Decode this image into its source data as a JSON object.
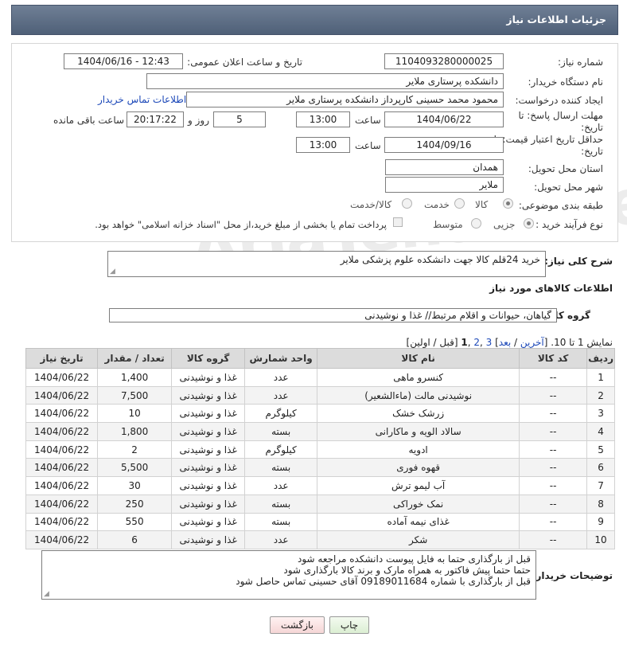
{
  "header": {
    "title": "جزئیات اطلاعات نیاز"
  },
  "form": {
    "need_number_label": "شماره نیاز:",
    "need_number": "1104093280000025",
    "announce_label": "تاریخ و ساعت اعلان عمومی:",
    "announce_value": "1404/06/16 - 12:43",
    "buyer_org_label": "نام دستگاه خریدار:",
    "buyer_org": "دانشکده پرستاری ملایر",
    "requester_label": "ایجاد کننده درخواست:",
    "requester": "محمود محمد حسینی کارپرداز دانشکده پرستاری ملایر",
    "buyer_contact_link": "اطلاعات تماس خریدار",
    "reply_deadline_label": "مهلت ارسال پاسخ: تا تاریخ:",
    "reply_date": "1404/06/22",
    "time_label": "ساعت",
    "reply_time": "13:00",
    "days_value": "5",
    "days_label": "روز و",
    "remaining_time": "20:17:22",
    "remaining_label": "ساعت باقی مانده",
    "price_validity_label": "حداقل تاریخ اعتبار قیمت: تا تاریخ:",
    "validity_date": "1404/09/16",
    "validity_time": "13:00",
    "province_label": "استان محل تحویل:",
    "province": "همدان",
    "city_label": "شهر محل تحویل:",
    "city": "ملایر",
    "category_label": "طبقه بندی موضوعی:",
    "category_options": [
      "کالا",
      "خدمت",
      "کالا/خدمت"
    ],
    "category_selected": "کالا",
    "process_label": "نوع فرآیند خرید :",
    "process_options": [
      "جزیی",
      "متوسط"
    ],
    "process_selected": "جزیی",
    "treasury_note": "پرداخت تمام یا بخشی از مبلغ خرید،از محل \"اسناد خزانه اسلامی\" خواهد بود."
  },
  "summary": {
    "label": "شرح کلی نیاز:",
    "text": "خرید 24قلم کالا جهت دانشکده علوم پزشکی ملایر"
  },
  "goods_section_title": "اطلاعات کالاهای مورد نیاز",
  "goods_group": {
    "label": "گروه کالا:",
    "value": "گیاهان، حیوانات و اقلام مرتبط// غذا و نوشیدنی"
  },
  "pagination": {
    "prefix": "نمایش 1 تا 10. [",
    "last": "آخرین",
    "sep1": " / ",
    "next": "بعد",
    "pages_open": "] ",
    "page3": "3",
    "comma1": " ,",
    "page2": "2",
    "comma2": " ,",
    "page1": "1",
    "suffix": " [قبل / اولین]"
  },
  "table": {
    "headers": [
      "ردیف",
      "کد کالا",
      "نام کالا",
      "واحد شمارش",
      "گروه کالا",
      "تعداد / مقدار",
      "تاریخ نیاز"
    ],
    "rows": [
      [
        "1",
        "--",
        "کنسرو ماهی",
        "عدد",
        "غذا و نوشیدنی",
        "1,400",
        "1404/06/22"
      ],
      [
        "2",
        "--",
        "نوشیدنی مالت (ماءالشعیر)",
        "عدد",
        "غذا و نوشیدنی",
        "7,500",
        "1404/06/22"
      ],
      [
        "3",
        "--",
        "زرشک خشک",
        "کیلوگرم",
        "غذا و نوشیدنی",
        "10",
        "1404/06/22"
      ],
      [
        "4",
        "--",
        "سالاد الویه و ماکارانی",
        "بسته",
        "غذا و نوشیدنی",
        "1,800",
        "1404/06/22"
      ],
      [
        "5",
        "--",
        "ادویه",
        "کیلوگرم",
        "غذا و نوشیدنی",
        "2",
        "1404/06/22"
      ],
      [
        "6",
        "--",
        "قهوه فوری",
        "بسته",
        "غذا و نوشیدنی",
        "5,500",
        "1404/06/22"
      ],
      [
        "7",
        "--",
        "آب لیمو ترش",
        "عدد",
        "غذا و نوشیدنی",
        "30",
        "1404/06/22"
      ],
      [
        "8",
        "--",
        "نمک خوراکی",
        "بسته",
        "غذا و نوشیدنی",
        "250",
        "1404/06/22"
      ],
      [
        "9",
        "--",
        "غذای نیمه آماده",
        "بسته",
        "غذا و نوشیدنی",
        "550",
        "1404/06/22"
      ],
      [
        "10",
        "--",
        "شکر",
        "عدد",
        "غذا و نوشیدنی",
        "6",
        "1404/06/22"
      ]
    ]
  },
  "buyer_notes": {
    "label": "توضیحات خریدار:",
    "lines": [
      "قبل از بارگذاری حتما به فایل پیوست دانشکده مراجعه شود",
      "حتما حتما پیش فاکتور به همراه مارک و برند کالا بارگذاری شود",
      "قبل از بارگذاری با شماره 09189011684 آقای حسینی تماس حاصل شود"
    ]
  },
  "buttons": {
    "print": "چاپ",
    "back": "بازگشت"
  },
  "watermark": "AriaTender.neT"
}
